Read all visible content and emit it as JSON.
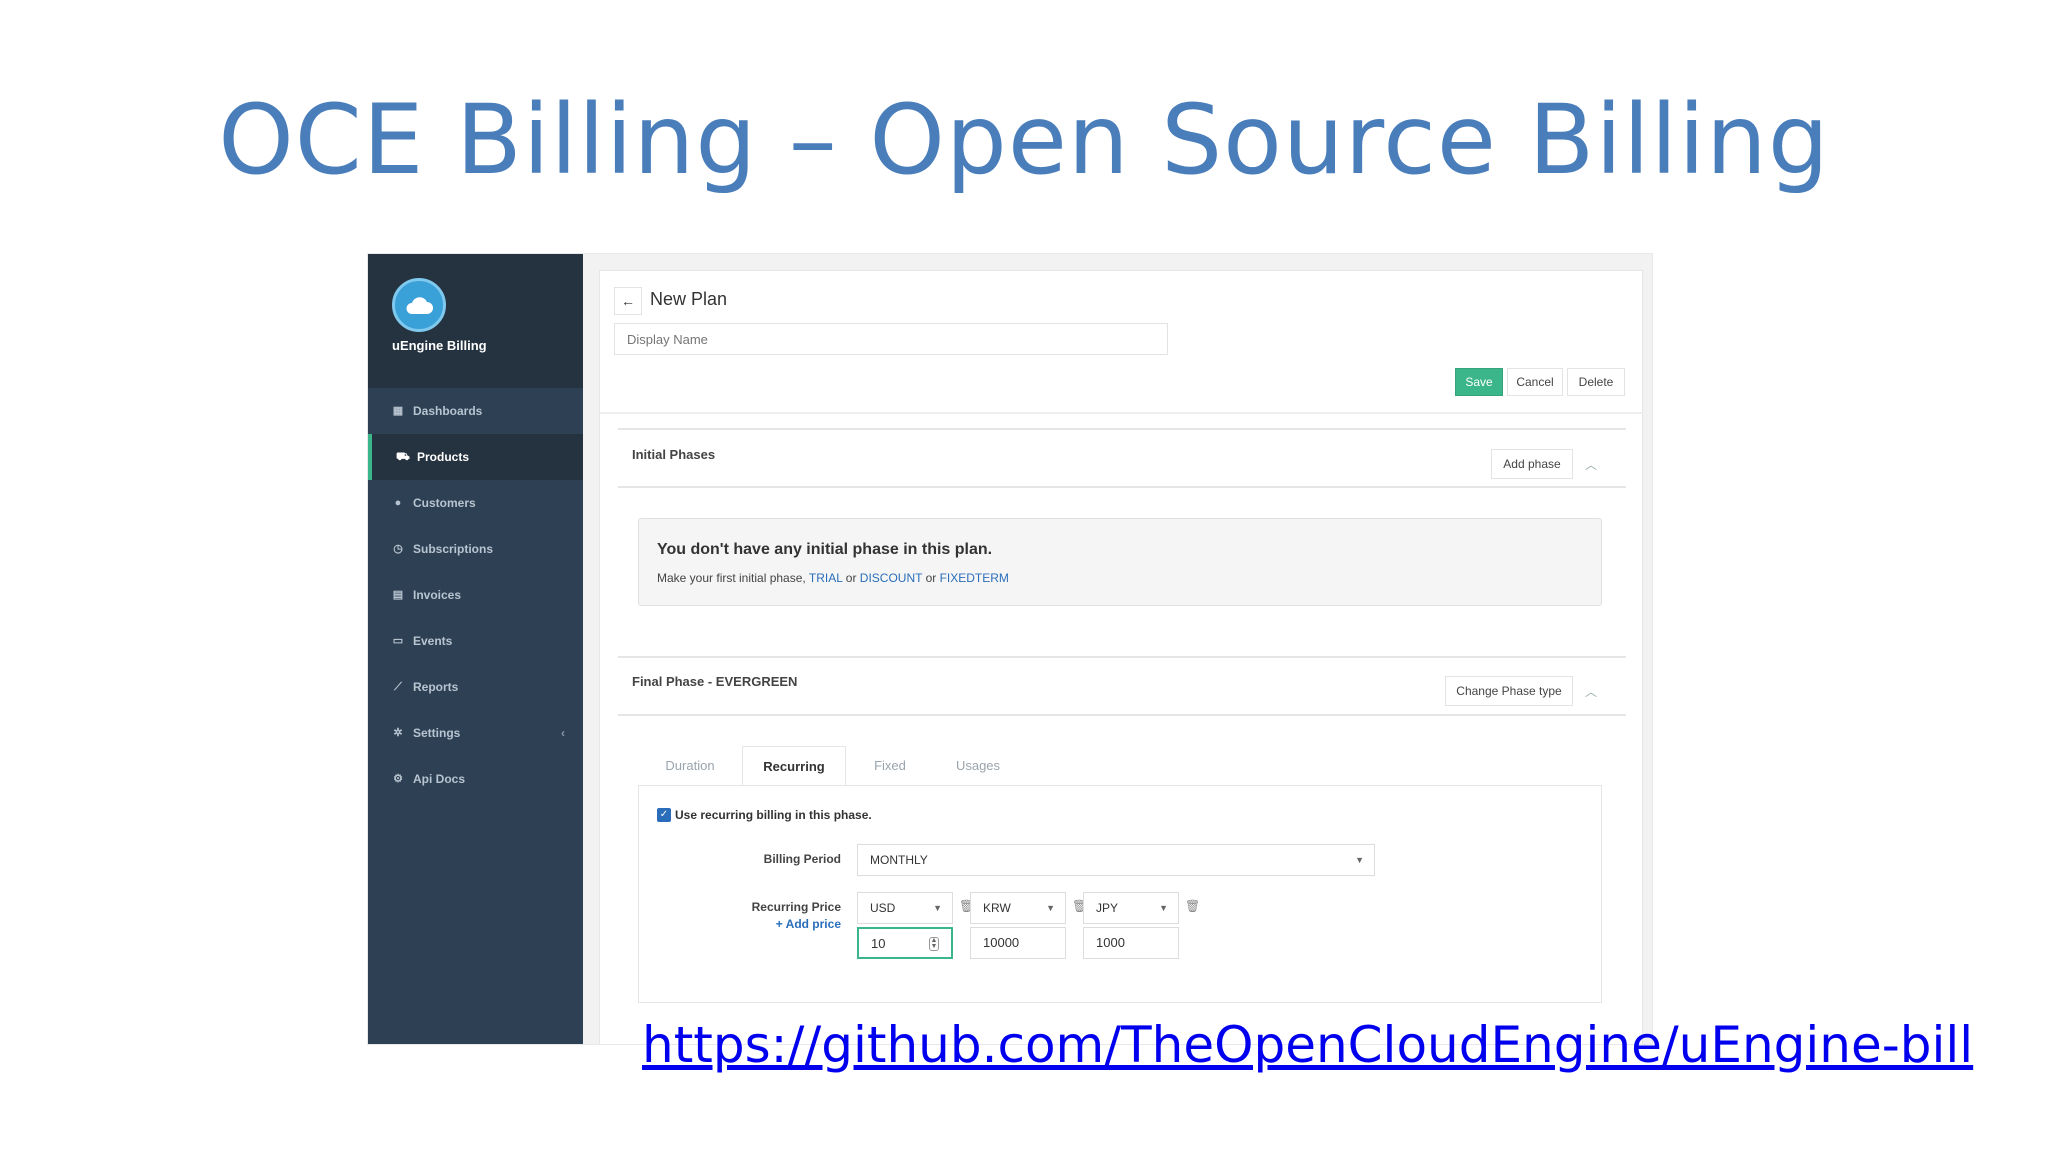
{
  "slide": {
    "title": "OCE Billing – Open Source Billing",
    "link_text": "https://github.com/TheOpenCloudEngine/uEngine-bill"
  },
  "sidebar": {
    "brand": "uEngine Billing",
    "items": [
      {
        "label": "Dashboards",
        "icon": "grid-icon"
      },
      {
        "label": "Products",
        "icon": "cart-icon",
        "active": true
      },
      {
        "label": "Customers",
        "icon": "user-icon"
      },
      {
        "label": "Subscriptions",
        "icon": "clock-icon"
      },
      {
        "label": "Invoices",
        "icon": "document-icon"
      },
      {
        "label": "Events",
        "icon": "calendar-icon"
      },
      {
        "label": "Reports",
        "icon": "chart-icon"
      },
      {
        "label": "Settings",
        "icon": "gear-icon"
      },
      {
        "label": "Api Docs",
        "icon": "cogs-icon"
      }
    ]
  },
  "header": {
    "back_icon": "arrow-left-icon",
    "title": "New Plan",
    "display_name_placeholder": "Display Name"
  },
  "toolbar": {
    "save_label": "Save",
    "cancel_label": "Cancel",
    "delete_label": "Delete"
  },
  "initial_phases": {
    "title": "Initial Phases",
    "button": "Add phase",
    "notice_title": "You don't have any initial phase in this plan.",
    "notice_prefix": "Make your first initial phase,",
    "trial": "TRIAL",
    "or1": "or",
    "discount": "DISCOUNT",
    "or2": "or",
    "fixedterm": "FIXEDTERM"
  },
  "final_phase": {
    "title": "Final Phase - EVERGREEN",
    "button": "Change Phase type",
    "tabs": [
      "Duration",
      "Recurring",
      "Fixed",
      "Usages"
    ],
    "active_tab": "Recurring",
    "checkbox_label": "Use recurring billing in this phase.",
    "checkbox_checked": true,
    "billing_period_label": "Billing Period",
    "billing_period_value": "MONTHLY",
    "recurring_price_label": "Recurring Price",
    "add_price": "+ Add price",
    "prices": [
      {
        "currency": "USD",
        "amount": "10"
      },
      {
        "currency": "KRW",
        "amount": "10000"
      },
      {
        "currency": "JPY",
        "amount": "1000"
      }
    ]
  },
  "colors": {
    "title_blue": "#4a7ebb",
    "sidebar_bg": "#2e4054",
    "save_green": "#3bb58a",
    "link_blue": "#2a6ebb"
  }
}
